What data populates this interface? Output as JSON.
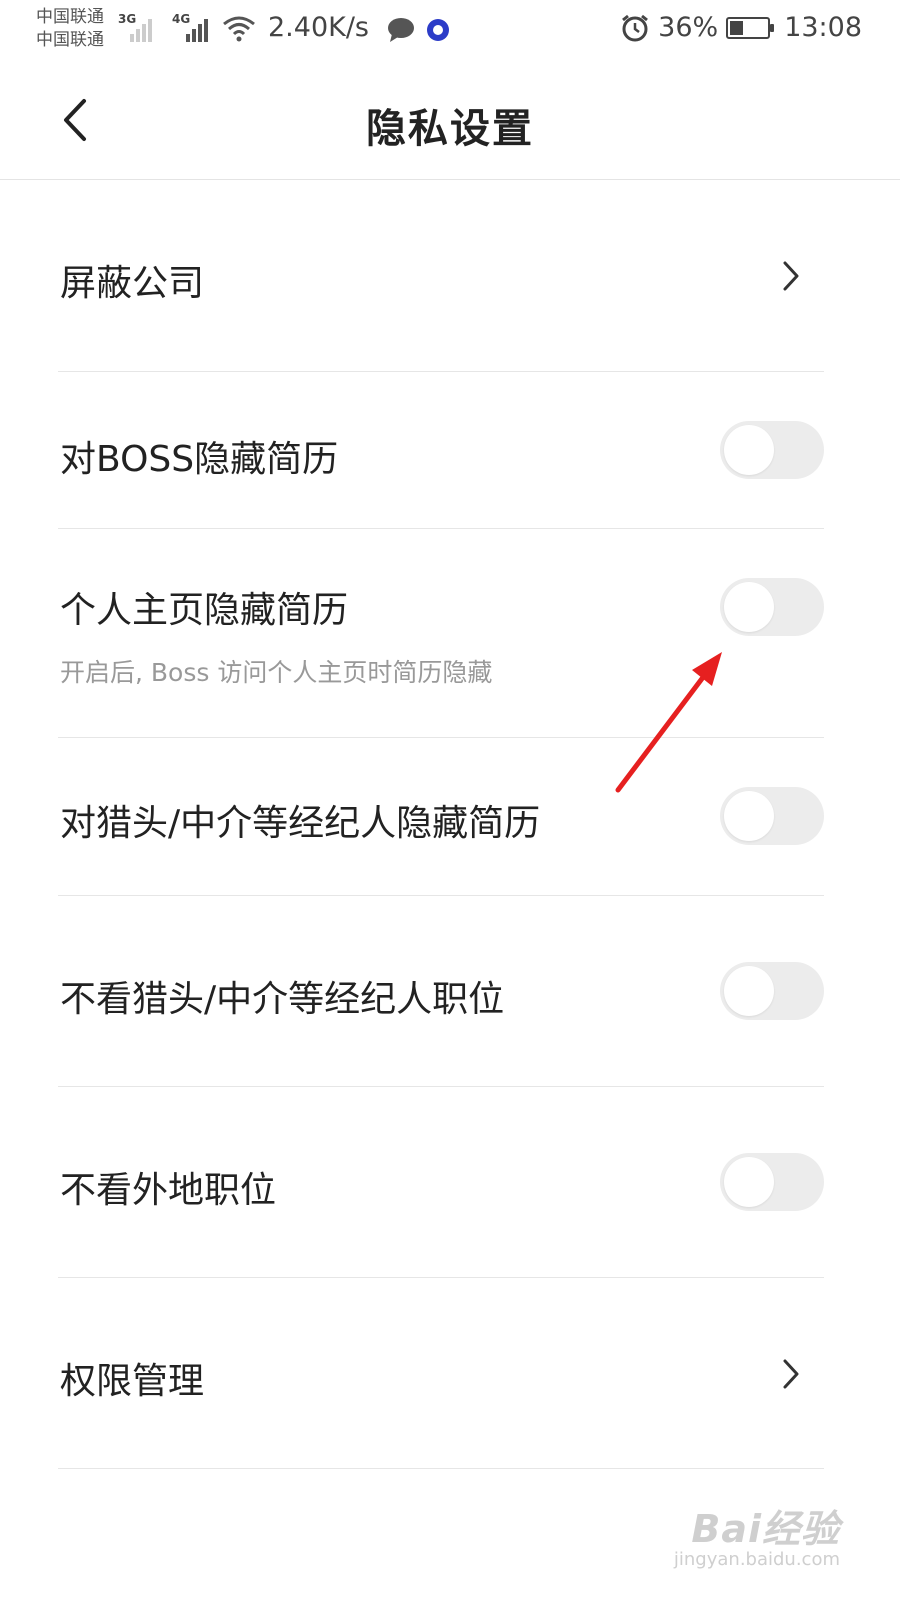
{
  "status_bar": {
    "carrier_1": "中国联通",
    "carrier_2": "中国联通",
    "net_1": "3G",
    "net_2": "4G",
    "speed": "2.40K/s",
    "battery_percent": "36%",
    "battery_level": 0.36,
    "time": "13:08",
    "icons": [
      "signal-3g-icon",
      "signal-4g-icon",
      "wifi-icon",
      "chat-icon",
      "app-notification-icon",
      "alarm-icon",
      "battery-charging-icon"
    ]
  },
  "nav": {
    "title": "隐私设置",
    "back_icon": "chevron-left-icon"
  },
  "settings": {
    "block_companies": {
      "label": "屏蔽公司"
    },
    "hide_from_boss": {
      "label": "对BOSS隐藏简历",
      "on": false
    },
    "hide_on_homepage": {
      "label": "个人主页隐藏简历",
      "sub": "开启后, Boss 访问个人主页时简历隐藏",
      "on": false
    },
    "hide_from_headhunters": {
      "label": "对猎头/中介等经纪人隐藏简历",
      "on": false
    },
    "hide_headhunter_jobs": {
      "label": "不看猎头/中介等经纪人职位",
      "on": false
    },
    "hide_other_city_jobs": {
      "label": "不看外地职位",
      "on": false
    },
    "permission_management": {
      "label": "权限管理"
    }
  },
  "annotation": {
    "color": "#e62020"
  },
  "watermark": {
    "main": "Bai经验",
    "url": "jingyan.baidu.com"
  }
}
